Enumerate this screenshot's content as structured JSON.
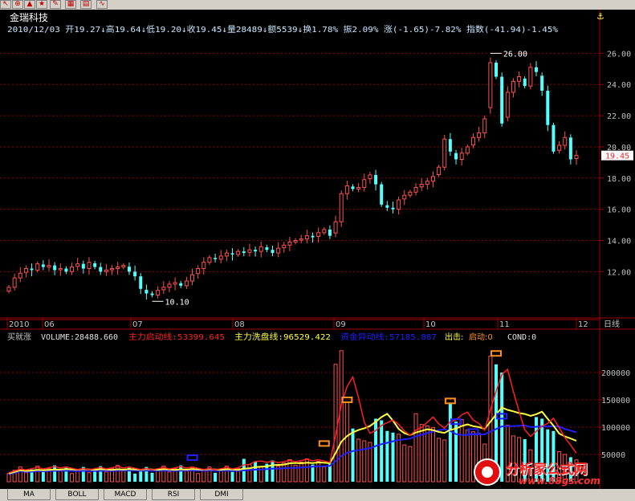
{
  "toolbar": {
    "icons": [
      "pointer-icon",
      "zoom-icon",
      "alarm-icon",
      "favorite-icon",
      "pencil-icon",
      "grid-icon",
      "table-icon",
      "chart-icon"
    ]
  },
  "stock": {
    "name": "金瑞科技",
    "info_line": "2010/12/03 开19.27↓高19.64↓低19.20↓收19.45↓量28489↓额5539↓换1.78% 振2.09% 涨(-1.65)-7.82% 指数(-41.94)-1.45%"
  },
  "colors": {
    "background": "#000000",
    "up": "#ff5050",
    "down": "#54ffff",
    "grid": "#900000",
    "text": "#c0c0c0",
    "yellow": "#ffff40",
    "blue": "#2020ff",
    "red_line": "#ff2020"
  },
  "chart_data": [
    {
      "type": "candlestick",
      "title": "金瑞科技",
      "x_labels": [
        "2010",
        "06",
        "07",
        "08",
        "09",
        "10",
        "11",
        "12",
        "日线"
      ],
      "y_ticks": [
        "26.00",
        "24.00",
        "22.00",
        "20.00",
        "18.00",
        "16.00",
        "14.00",
        "12.00"
      ],
      "ylim": [
        9.6,
        27.1
      ],
      "close_series": [
        11.0,
        11.6,
        11.9,
        12.2,
        12.1,
        12.5,
        12.3,
        12.4,
        12.1,
        12.2,
        12.0,
        12.3,
        12.5,
        12.2,
        12.6,
        12.3,
        12.0,
        12.1,
        12.2,
        12.3,
        12.4,
        12.0,
        11.7,
        10.9,
        10.6,
        10.5,
        10.8,
        11.0,
        11.2,
        11.3,
        11.1,
        11.4,
        11.8,
        12.2,
        12.6,
        12.9,
        12.8,
        13.0,
        13.2,
        13.1,
        13.3,
        13.2,
        13.4,
        13.3,
        13.6,
        13.4,
        13.2,
        13.5,
        13.7,
        13.9,
        14.0,
        14.1,
        14.3,
        14.2,
        14.5,
        14.7,
        14.3,
        15.2,
        17.0,
        17.5,
        17.3,
        17.4,
        17.9,
        18.2,
        17.6,
        16.3,
        16.1,
        16.0,
        16.6,
        16.9,
        17.1,
        17.4,
        17.6,
        17.8,
        18.1,
        18.7,
        20.5,
        19.7,
        19.2,
        19.6,
        20.0,
        20.6,
        20.9,
        21.8,
        25.4,
        24.5,
        21.5,
        23.5,
        24.2,
        24.5,
        23.9,
        25.1,
        24.8,
        23.6,
        21.4,
        19.7,
        20.1,
        20.6,
        19.2,
        19.45
      ],
      "annotations": [
        {
          "label": "26.00",
          "value": 26.0
        },
        {
          "label": "10.10",
          "value": 10.1
        },
        {
          "label": "19.45",
          "value": 19.45
        }
      ]
    },
    {
      "type": "bar",
      "title": "买就涨",
      "y_ticks": [
        "200000",
        "150000",
        "100000",
        "50000"
      ],
      "ylim": [
        0,
        250000
      ],
      "series": [
        {
          "name": "VOLUME",
          "value": 28488.66
        },
        {
          "name": "主力启动线",
          "value": 53399.645
        },
        {
          "name": "主力洗盘线",
          "value": 96529.422
        },
        {
          "name": "资金异动线",
          "value": 57185.887
        }
      ]
    }
  ],
  "indicator": {
    "label_prefix": "买就涨",
    "volume": "VOLUME:28488.660",
    "start_line": "主力启动线:53399.645",
    "wash_line": "主力洗盘线:96529.422",
    "fund_line": "资金异动线:57185.887",
    "out_label": "出击:",
    "start": "启动:0",
    "cond": "COND:0"
  },
  "tabs": [
    "MA",
    "BOLL",
    "MACD",
    "RSI",
    "DMI"
  ],
  "watermark": {
    "title": "分析家公式网",
    "url": "www.88gs.com"
  }
}
